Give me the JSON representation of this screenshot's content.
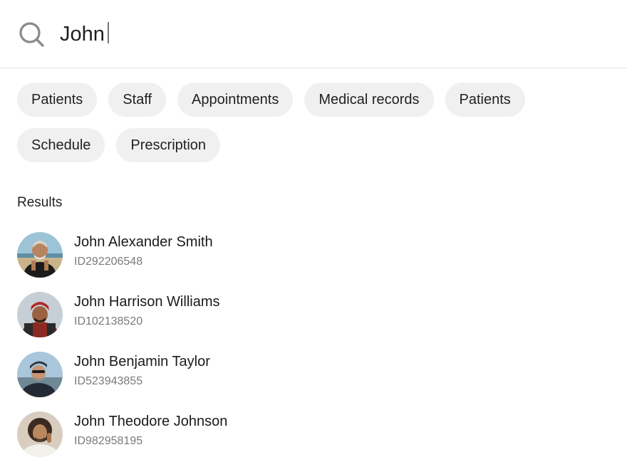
{
  "search": {
    "value": "John",
    "icon": "search-icon"
  },
  "filters": [
    "Patients",
    "Staff",
    "Appointments",
    "Medical records",
    "Patients",
    "Schedule",
    "Prescription"
  ],
  "results": {
    "label": "Results",
    "items": [
      {
        "name": "John Alexander Smith",
        "id": "ID292206548"
      },
      {
        "name": "John Harrison Williams",
        "id": "ID102138520"
      },
      {
        "name": "John Benjamin Taylor",
        "id": "ID523943855"
      },
      {
        "name": "John Theodore Johnson",
        "id": "ID982958195"
      }
    ]
  },
  "colors": {
    "chip_bg": "#f0f0f0",
    "divider": "#e3e3e3",
    "muted_text": "#7a7a7a"
  }
}
